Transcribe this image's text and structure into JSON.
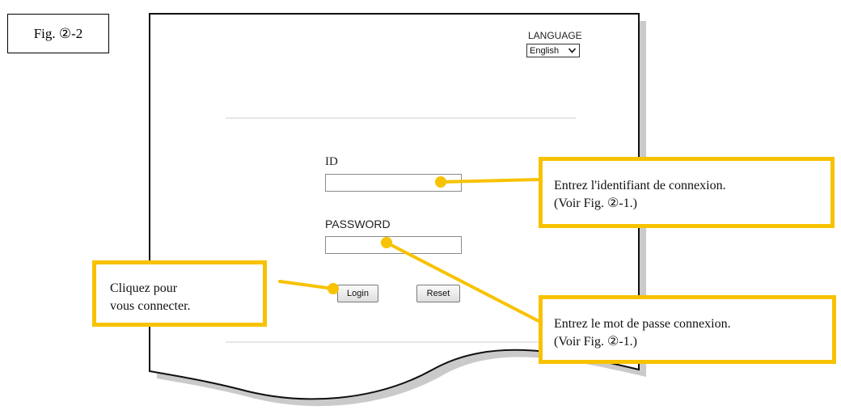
{
  "figure": {
    "label": "Fig. ②-2"
  },
  "language": {
    "label": "LANGUAGE",
    "selected": "English"
  },
  "login_form": {
    "id_label": "ID",
    "id_value": "",
    "password_label": "PASSWORD",
    "password_value": "",
    "login_button": "Login",
    "reset_button": "Reset"
  },
  "callouts": {
    "id_hint": {
      "line1": "Entrez l'identifiant de connexion.",
      "line2": "(Voir Fig. ②-1.)"
    },
    "password_hint": {
      "line1": "Entrez le mot de passe connexion.",
      "line2": "(Voir Fig. ②-1.)"
    },
    "login_hint": {
      "line1": "Cliquez pour",
      "line2": "vous connecter."
    }
  },
  "colors": {
    "callout_accent": "#f7c200",
    "paper_border": "#111111"
  },
  "icons": {
    "select_arrow": "chevron-down-icon"
  }
}
